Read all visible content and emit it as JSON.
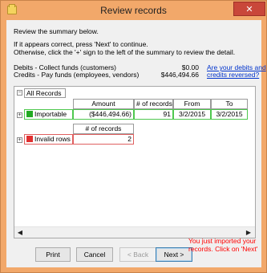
{
  "window": {
    "title": "Review records",
    "close_glyph": "✕",
    "accent": "#f2a86a",
    "close_color": "#c9473a"
  },
  "intro": {
    "line1": "Review the summary below.",
    "line2": "If it appears correct, press 'Next' to continue.",
    "line3": "Otherwise, click the '+' sign to the left of the summary to review the detail."
  },
  "summary": {
    "debits_label": "Debits  - Collect funds (customers)",
    "debits_amount": "$0.00",
    "credits_label": "Credits - Pay funds (employees, vendors)",
    "credits_amount": "$446,494.66",
    "link_line1": "Are your debits and",
    "link_line2": "credits reversed?"
  },
  "tree": {
    "root_label": "All Records",
    "root_expander": "−",
    "importable": {
      "expander": "+",
      "label": "Importable",
      "color": "#22aa22",
      "headers": [
        "Amount",
        "# of records",
        "From",
        "To"
      ],
      "amount": "($446,494.66)",
      "records": "91",
      "from": "3/2/2015",
      "to": "3/2/2015"
    },
    "invalid": {
      "expander": "+",
      "label": "Invalid rows",
      "color": "#e03030",
      "header": "# of records",
      "records": "2"
    }
  },
  "scrollbar": {
    "left_arrow": "◀",
    "right_arrow": "▶"
  },
  "buttons": {
    "print": "Print",
    "cancel": "Cancel",
    "back": "< Back",
    "next": "Next >"
  },
  "note": "You just imported your records. Click on 'Next'"
}
